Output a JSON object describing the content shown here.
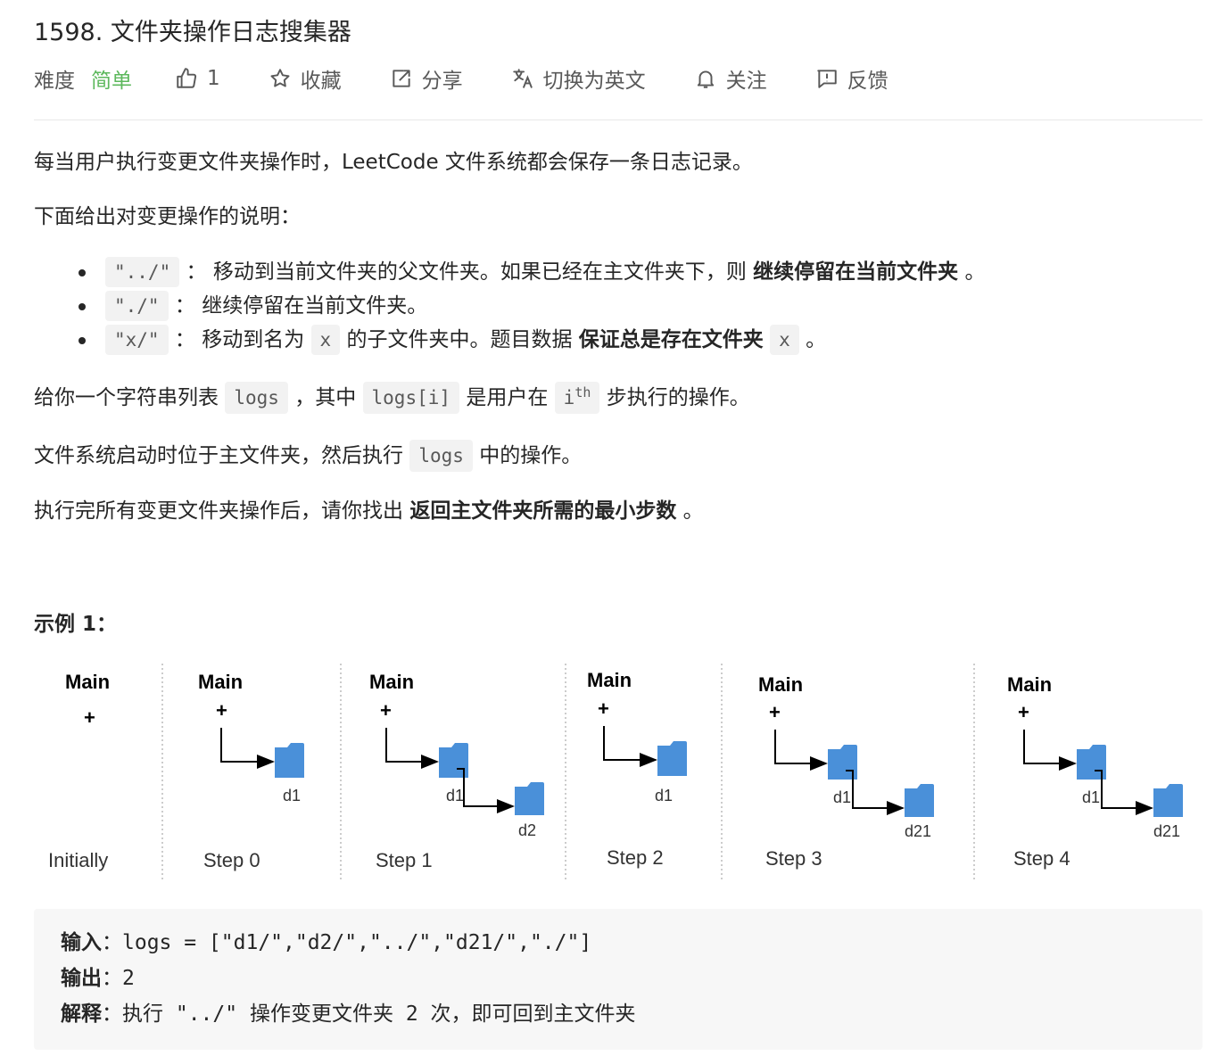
{
  "problem": {
    "title": "1598. 文件夹操作日志搜集器",
    "difficulty_label": "难度",
    "difficulty_value": "简单",
    "like_count": "1",
    "actions": {
      "favorite": "收藏",
      "share": "分享",
      "switch_language": "切换为英文",
      "follow": "关注",
      "feedback": "反馈"
    }
  },
  "description": {
    "p1": "每当用户执行变更文件夹操作时，LeetCode 文件系统都会保存一条日志记录。",
    "p2": "下面给出对变更操作的说明：",
    "ops": [
      {
        "code": "\"../\"",
        "sep": "：",
        "text": "移动到当前文件夹的父文件夹。如果已经在主文件夹下，则",
        "bold": "继续停留在当前文件夹",
        "tail": "。"
      },
      {
        "code": "\"./\"",
        "sep": "：",
        "text": "继续停留在当前文件夹。"
      },
      {
        "code": "\"x/\"",
        "sep": "：",
        "text": "移动到名为",
        "code2": "x",
        "text2": "的子文件夹中。题目数据",
        "bold": "保证总是存在文件夹",
        "code3": "x",
        "tail": "。"
      }
    ],
    "p3": {
      "a": "给你一个字符串列表",
      "code1": "logs",
      "b": "，其中",
      "code2": "logs[i]",
      "c": "是用户在",
      "code3": "i",
      "sup": "th",
      "d": "步执行的操作。"
    },
    "p4": {
      "a": "文件系统启动时位于主文件夹，然后执行",
      "code": "logs",
      "b": "中的操作。"
    },
    "p5": {
      "a": "执行完所有变更文件夹操作后，请你找出",
      "bold": "返回主文件夹所需的最小步数",
      "b": "。"
    }
  },
  "example": {
    "title": "示例 1：",
    "figure": {
      "root_label": "Main",
      "plus": "+",
      "steps": [
        "Initially",
        "Step 0",
        "Step 1",
        "Step 2",
        "Step 3",
        "Step 4"
      ],
      "folders": {
        "d1": "d1",
        "d2": "d2",
        "d21": "d21"
      },
      "folder_color": "#4a90d9"
    },
    "input_label": "输入",
    "input_value": "logs = [\"d1/\",\"d2/\",\"../\",\"d21/\",\"./\"]",
    "output_label": "输出",
    "output_value": "2",
    "explain_label": "解释",
    "explain_a": "执行",
    "explain_code": "\"../\"",
    "explain_b": "操作变更文件夹",
    "explain_num": "2",
    "explain_c": "次，即可回到主文件夹"
  },
  "colors": {
    "easy": "#5cb85c",
    "text": "#262626",
    "muted": "#595959",
    "code_bg": "#f2f2f2",
    "pre_bg": "#f7f7f7"
  }
}
